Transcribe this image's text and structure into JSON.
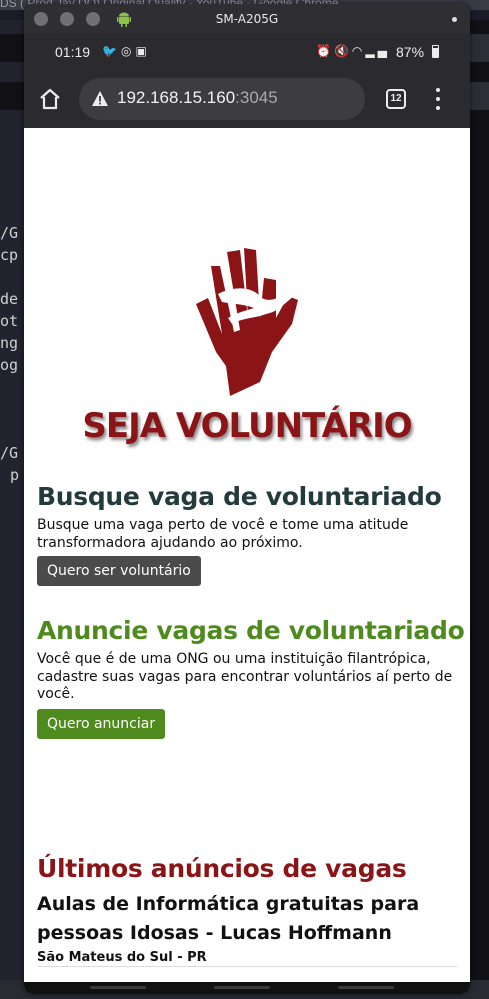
{
  "background_window": {
    "title_fragment": "DS ( Prod Jay DO) Original Quality - YouTube - Google Chrome",
    "code_fragments": [
      "/G",
      "cp",
      "de",
      "ot",
      "ng",
      "og",
      "/G",
      "p"
    ]
  },
  "window": {
    "title": "SM-A205G"
  },
  "status_bar": {
    "time": "01:19",
    "left_icons": [
      "twitter-icon",
      "instagram-icon",
      "news-icon"
    ],
    "right_icons": [
      "alarm-icon",
      "mute-icon",
      "wifi-icon",
      "signal-icon"
    ],
    "battery": "87%"
  },
  "browser": {
    "url_host": "192.168.15.160",
    "url_port": ":3045",
    "tab_count": "12",
    "colors": {
      "toolbar": "#2b2b2f",
      "omnibox": "#3c3c41"
    }
  },
  "page": {
    "banner_title": "SEJA VOLUNTÁRIO",
    "search_section": {
      "title": "Busque vaga de voluntariado",
      "description": "Busque uma vaga perto de você e tome uma atitude transformadora ajudando ao próximo.",
      "button": "Quero ser voluntário"
    },
    "post_section": {
      "title": "Anuncie vagas de voluntariado",
      "description": "Você que é de uma ONG ou uma instituição filantrópica, cadastre suas vagas para encontrar voluntários aí perto de você.",
      "button": "Quero anunciar"
    },
    "latest": {
      "title": "Últimos anúncios de vagas",
      "listings": [
        {
          "title": "Aulas de Informática gratuitas para pessoas Idosas - Lucas Hoffmann",
          "location": "São Mateus do Sul - PR"
        }
      ]
    },
    "colors": {
      "brand_red": "#8b1416",
      "green": "#4e8a1d",
      "dark_teal": "#243b3c",
      "grey_button": "#4b4b4b"
    }
  }
}
